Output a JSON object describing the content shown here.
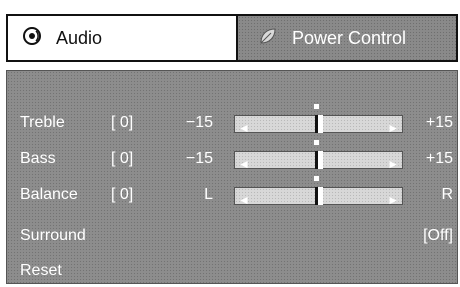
{
  "tabs": [
    {
      "label": "Audio",
      "icon": "speaker-icon",
      "active": true
    },
    {
      "label": "Power Control",
      "icon": "leaf-icon",
      "active": false
    }
  ],
  "settings": [
    {
      "label": "Treble",
      "value": "[ 0]",
      "min_label": "−15",
      "max_label": "+15",
      "level": 0.5
    },
    {
      "label": "Bass",
      "value": "[ 0]",
      "min_label": "−15",
      "max_label": "+15",
      "level": 0.5
    },
    {
      "label": "Balance",
      "value": "[ 0]",
      "min_label": "L",
      "max_label": "R",
      "level": 0.5
    },
    {
      "label": "Surround",
      "value": "[Off]"
    },
    {
      "label": "Reset"
    }
  ],
  "colors": {
    "panel": "#8d8d8d",
    "slider_track": "#d8d8d8",
    "text": "#ffffff"
  }
}
